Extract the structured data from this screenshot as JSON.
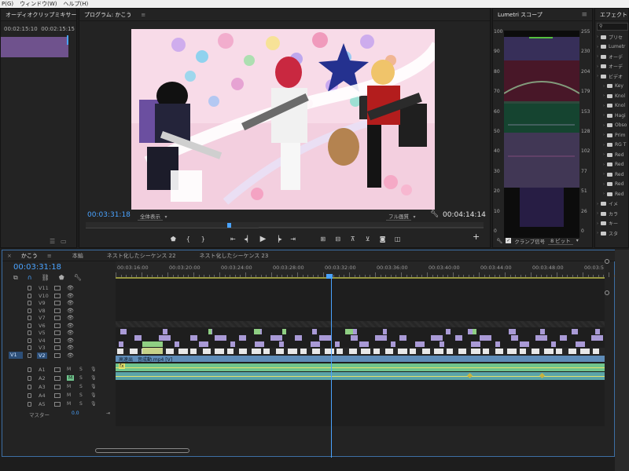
{
  "menubar": [
    "P(G)",
    "ウィンドウ(W)",
    "ヘルプ(H)"
  ],
  "mixer": {
    "tab": "オーディオクリップミキサー",
    "tc_left": "00:02:15:10",
    "tc_right": "00:02:15:15"
  },
  "program": {
    "tab": "プログラム: かこう",
    "timecode": "00:03:31:18",
    "fit": "全体表示",
    "quality": "フル画質",
    "duration": "00:04:14:14",
    "transport_icons": [
      "marker-icon",
      "in-point-icon",
      "out-point-icon",
      "go-to-in-icon",
      "step-back-icon",
      "play-icon",
      "step-forward-icon",
      "go-to-out-icon",
      "insert-icon",
      "overwrite-icon",
      "lift-icon",
      "extract-icon",
      "export-frame-icon",
      "compare-view-icon"
    ],
    "add_button": "+"
  },
  "lumetri": {
    "tab": "Lumetri スコープ",
    "left_scale": [
      "100",
      "90",
      "80",
      "70",
      "60",
      "50",
      "40",
      "30",
      "20",
      "10",
      "0"
    ],
    "right_scale": [
      "255",
      "230",
      "204",
      "179",
      "153",
      "128",
      "102",
      "77",
      "51",
      "26",
      "0"
    ],
    "clamp_label": "クランプ信号",
    "bit_depth": "8 ビット"
  },
  "effects": {
    "tab": "エフェクト",
    "items": [
      "プリセ",
      "Lumetr",
      "オーデ",
      "オーデ",
      "ビデオ",
      "Key",
      "Knol",
      "Knol",
      "Hagi",
      "Obso",
      "Prim",
      "RG T",
      "Red",
      "Red",
      "Red",
      "Red",
      "Red",
      "イメ",
      "カラ",
      "キー",
      "スタ"
    ]
  },
  "timeline": {
    "sequence_tab": "かこう",
    "tabs": [
      "本編",
      "ネスト化したシーケンス 22",
      "ネスト化したシーケンス 23"
    ],
    "timecode": "00:03:31:18",
    "ruler_labels": [
      "00:03:16:00",
      "00:03:20:00",
      "00:03:24:00",
      "00:03:28:00",
      "00:03:32:00",
      "00:03:36:00",
      "00:03:40:00",
      "00:03:44:00",
      "00:03:48:00",
      "00:03:5"
    ],
    "video_tracks": [
      "V11",
      "V10",
      "V9",
      "V8",
      "V7",
      "V6",
      "V5",
      "V4",
      "V3",
      "V2"
    ],
    "source_label": "V1",
    "audio_tracks": [
      "A1",
      "A2",
      "A3",
      "A4",
      "A5"
    ],
    "master_label": "マスター",
    "master_value": "0.0",
    "audio_clip_label": "高速出　音成動.mp4 [V]",
    "mute_label": "M",
    "solo_label": "S",
    "fx_label": "fx"
  },
  "colors": {
    "accent_blue": "#4aa3ff",
    "clip_violet": "#a99ad6",
    "clip_green": "#8fcf83",
    "audio_green": "#6fc48c",
    "audio_teal": "#5aa4a8"
  }
}
